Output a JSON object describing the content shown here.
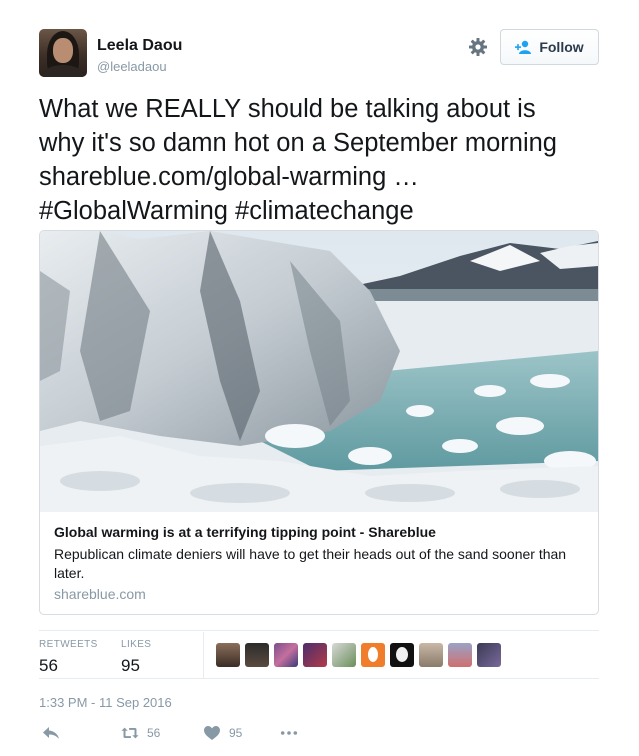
{
  "user": {
    "name": "Leela Daou",
    "handle": "@leeladaou"
  },
  "follow_button": {
    "label": "Follow"
  },
  "tweet": {
    "lines": [
      "What we REALLY should be talking about is",
      "why it's so damn hot on a September morning",
      "shareblue.com/global-warming …",
      "#GlobalWarming #climatechange"
    ]
  },
  "card": {
    "title": "Global warming is at a terrifying tipping point - Shareblue",
    "description": "Republican climate deniers will have to get their heads out of the sand sooner than later.",
    "domain": "shareblue.com"
  },
  "stats": {
    "retweets_label": "RETWEETS",
    "retweets_value": "56",
    "likes_label": "LIKES",
    "likes_value": "95"
  },
  "timestamp": "1:33 PM - 11 Sep 2016",
  "actions": {
    "retweet_count": "56",
    "like_count": "95"
  },
  "colors": {
    "link": "#14171a",
    "muted": "#8899a6",
    "border": "#e6ecf0"
  },
  "icons": [
    "gear-icon",
    "follow-person-icon",
    "reply-icon",
    "retweet-icon",
    "heart-icon",
    "more-icon"
  ]
}
